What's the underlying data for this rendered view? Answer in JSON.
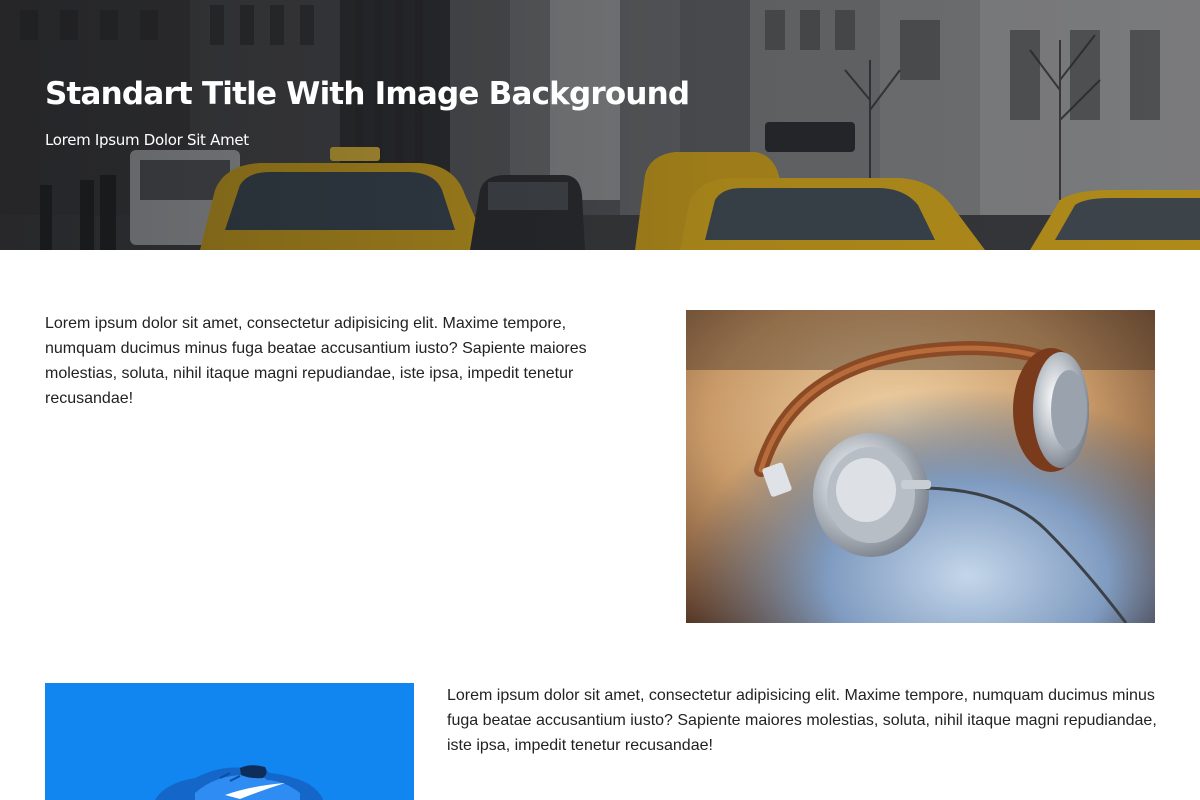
{
  "hero": {
    "title": "Standart Title With Image Background",
    "subtitle": "Lorem Ipsum Dolor Sit Amet",
    "background_image": "city-street-taxis"
  },
  "sections": [
    {
      "text": "Lorem ipsum dolor sit amet, consectetur adipisicing elit. Maxime tempore, numquam ducimus minus fuga beatae accusantium iusto? Sapiente maiores molestias, soluta, nihil itaque magni repudiandae, iste ipsa, impedit tenetur recusandae!",
      "image": "headphones-photo",
      "image_side": "right"
    },
    {
      "text": "Lorem ipsum dolor sit amet, consectetur adipisicing elit. Maxime tempore, numquam ducimus minus fuga beatae accusantium iusto? Sapiente maiores molestias, soluta, nihil itaque magni repudiandae, iste ipsa, impedit tenetur recusandae!",
      "image": "blue-sneaker-photo",
      "image_side": "left"
    }
  ],
  "colors": {
    "hero_text": "#ffffff",
    "body_text": "#222222",
    "taxi_yellow": "#e3b21c",
    "shoe_background": "#1185f0",
    "page_background": "#ffffff"
  }
}
